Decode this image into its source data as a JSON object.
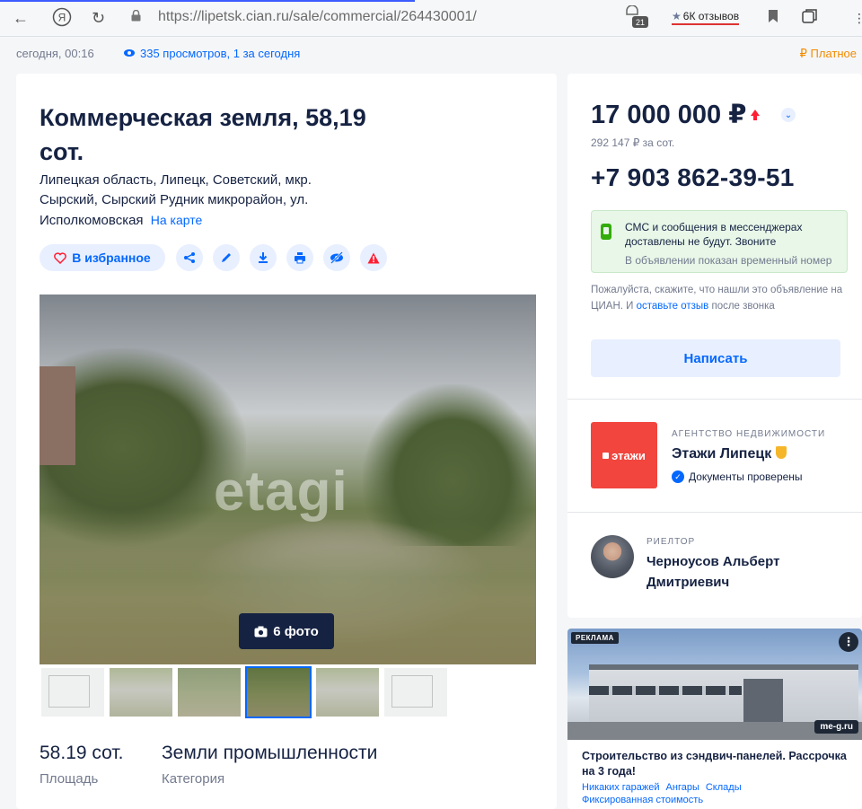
{
  "browser": {
    "url_host": "https://lipetsk.cian.ru",
    "url_path": "/sale/commercial/264430001/",
    "tab_badge": "21",
    "reviews": "6К отзывов"
  },
  "meta": {
    "date": "сегодня, 00:16",
    "views": "335 просмотров, 1 за сегодня",
    "paid": "₽ Платное"
  },
  "listing": {
    "title": "Коммерческая земля, 58,19 сот.",
    "address": "Липецкая область, Липецк, Советский, мкр. Сырский, Сырский Рудник микрорайон, ул. Исполкомовская",
    "map_link": "На карте",
    "favorite_label": "В избранное",
    "watermark": "etagi",
    "photo_count": "6 фото",
    "specs": [
      {
        "value": "58.19 сот.",
        "label": "Площадь"
      },
      {
        "value": "Земли промышленности",
        "label": "Категория"
      }
    ]
  },
  "pricing": {
    "price": "17 000 000 ₽",
    "per_unit": "292 147 ₽ за сот.",
    "phone": "+7 903 862-39-51",
    "sms_notice": "СМС и сообщения в мессенджерах доставлены не будут. Звоните",
    "temp_number": "В объявлении показан временный номер",
    "notice_before": "Пожалуйста, скажите, что нашли это объявление на ЦИАН. И ",
    "notice_link": "оставьте отзыв",
    "notice_after": " после звонка",
    "write_button": "Написать"
  },
  "agency": {
    "logo_text": "этажи",
    "kind": "АГЕНТСТВО НЕДВИЖИМОСТИ",
    "name": "Этажи Липецк",
    "verified": "Документы проверены"
  },
  "realtor": {
    "kind": "РИЕЛТОР",
    "name": "Черноусов Альберт Дмитриевич"
  },
  "ad": {
    "label": "РЕКЛАМА",
    "brand": "me-g.ru",
    "title": "Строительство из сэндвич-панелей. Рассрочка на 3 года!",
    "links": [
      "Никаких гаражей",
      "Ангары",
      "Склады",
      "Фиксированная стоимость"
    ]
  },
  "colors": {
    "accent": "#0468ff",
    "text": "#152242",
    "muted": "#737a8e",
    "price_up": "#ff1f34",
    "agency_red": "#f1453d",
    "paid_orange": "#f28c00"
  }
}
